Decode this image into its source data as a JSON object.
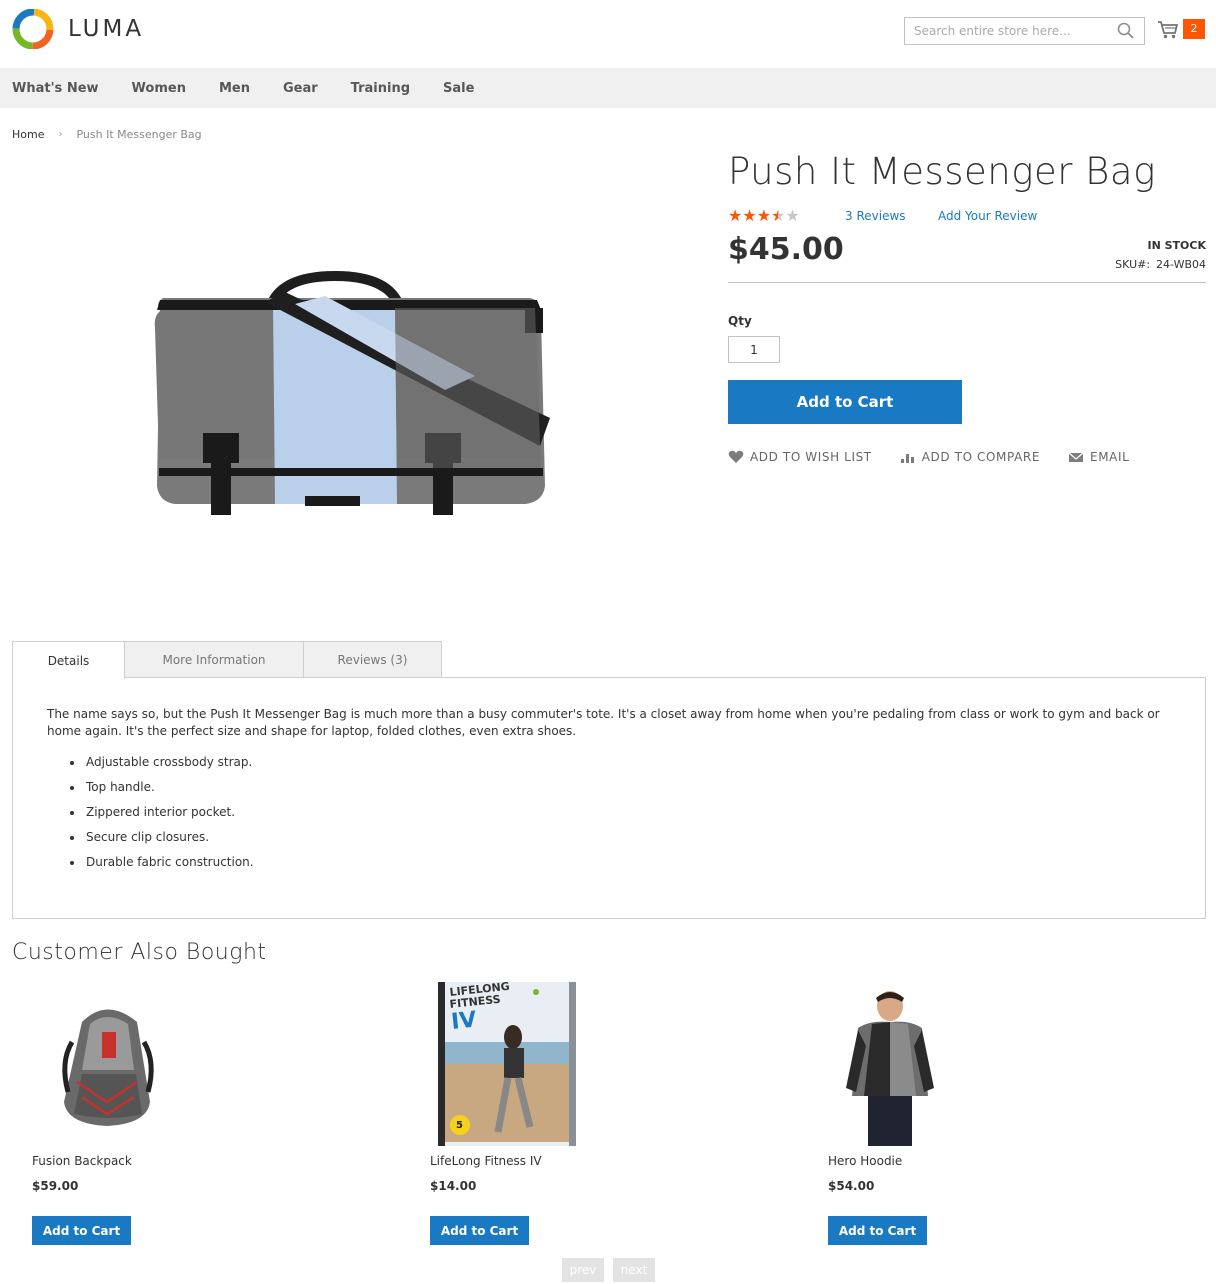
{
  "header": {
    "logo_text": "LUMA",
    "search_placeholder": "Search entire store here...",
    "cart_count": "2"
  },
  "nav": {
    "items": [
      "What's New",
      "Women",
      "Men",
      "Gear",
      "Training",
      "Sale"
    ]
  },
  "breadcrumb": {
    "home": "Home",
    "current": "Push It Messenger Bag"
  },
  "product": {
    "title": "Push It Messenger Bag",
    "rating_stars": 3.5,
    "rating_max": 5,
    "reviews_link": "3 Reviews",
    "add_review_link": "Add Your Review",
    "price": "$45.00",
    "stock": "IN STOCK",
    "sku_label": "SKU#:",
    "sku_value": "24-WB04",
    "qty_label": "Qty",
    "qty_value": "1",
    "add_to_cart": "Add to Cart",
    "actions": {
      "wishlist": "ADD TO WISH LIST",
      "compare": "ADD TO COMPARE",
      "email": "EMAIL"
    }
  },
  "tabs": {
    "details": "Details",
    "more_info": "More Information",
    "reviews": "Reviews (3)"
  },
  "details": {
    "description": "The name says so, but the Push It Messenger Bag is much more than a busy commuter's tote. It's a closet away from home when you're pedaling from class or work to gym and back or home again. It's the perfect size and shape for laptop, folded clothes, even extra shoes.",
    "features": [
      "Adjustable crossbody strap.",
      "Top handle.",
      "Zippered interior pocket.",
      "Secure clip closures.",
      "Durable fabric construction."
    ]
  },
  "also_bought": {
    "title": "Customer Also Bought",
    "products": [
      {
        "name": "Fusion Backpack",
        "price": "$59.00",
        "button": "Add to Cart"
      },
      {
        "name": "LifeLong Fitness IV",
        "price": "$14.00",
        "button": "Add to Cart"
      },
      {
        "name": "Hero Hoodie",
        "price": "$54.00",
        "button": "Add to Cart"
      }
    ],
    "book_cover": {
      "line1": "LIFELONG",
      "line2": "FITNESS",
      "line3": "IV",
      "badge": "5"
    }
  },
  "pager": {
    "prev": "prev",
    "next": "next"
  },
  "colors": {
    "accent": "#1979c3",
    "star": "#ff5501",
    "cart_badge": "#ff5501"
  }
}
